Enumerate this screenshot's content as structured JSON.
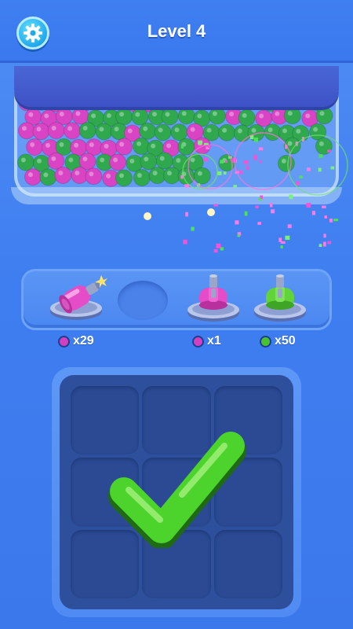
{
  "header": {
    "title": "Level 4",
    "settings_icon": "gear-icon"
  },
  "container": {
    "ball_colors": {
      "pink": "#d844c4",
      "green": "#2fa84e"
    }
  },
  "shelf": {
    "slots": [
      {
        "type": "cannon",
        "color": "pink",
        "state": "firing",
        "ammo_label": "x29"
      },
      {
        "type": "empty"
      },
      {
        "type": "cannon",
        "color": "pink",
        "state": "idle",
        "ammo_label": "x1"
      },
      {
        "type": "cannon",
        "color": "green",
        "state": "idle",
        "ammo_label": "x50"
      }
    ]
  },
  "grid": {
    "rows": 3,
    "cols": 3,
    "status_icon": "checkmark-icon"
  },
  "colors": {
    "background": "#3f7ef0",
    "pink": "#e24fc8",
    "green": "#5fd03a",
    "check_green": "#4cd42c"
  }
}
